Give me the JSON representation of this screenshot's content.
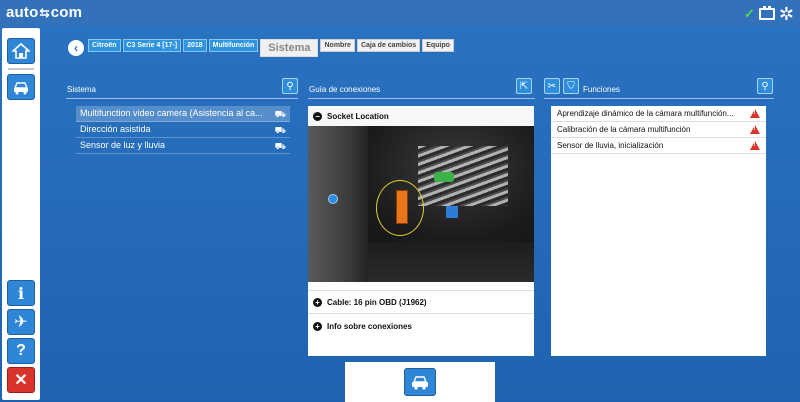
{
  "app": {
    "logo_left": "auto",
    "logo_sym": "⇆",
    "logo_right": "com"
  },
  "status": {
    "check": "✓"
  },
  "breadcrumb": {
    "items": [
      "Citroën",
      "C3 Serie 4 [17-]",
      "2018",
      "Multifunción"
    ],
    "active": "Sistema",
    "extra": [
      "Nombre",
      "Caja de cambios",
      "Equipo"
    ]
  },
  "sistema": {
    "title": "Sistema",
    "items": [
      {
        "label": "Multifunction video camera (Asistencia al ca...",
        "selected": true
      },
      {
        "label": "Dirección asistida",
        "selected": false
      },
      {
        "label": "Sensor de luz y lluvia",
        "selected": false
      }
    ]
  },
  "guia": {
    "title": "Guía de conexiones",
    "socket_location": "Socket Location",
    "cable": "Cable: 16 pin OBD (J1962)",
    "info": "Info sobre conexiones"
  },
  "funciones": {
    "title": "Funciones",
    "items": [
      "Aprendizaje dinámico de la cámara multifunción...",
      "Calibración de la cámara multifunción",
      "Sensor de lluvia, inicialización"
    ]
  },
  "colors": {
    "accent": "#2a73c2",
    "button": "#2f86d6",
    "warning": "#d9342b",
    "ok": "#4cdd4c"
  }
}
